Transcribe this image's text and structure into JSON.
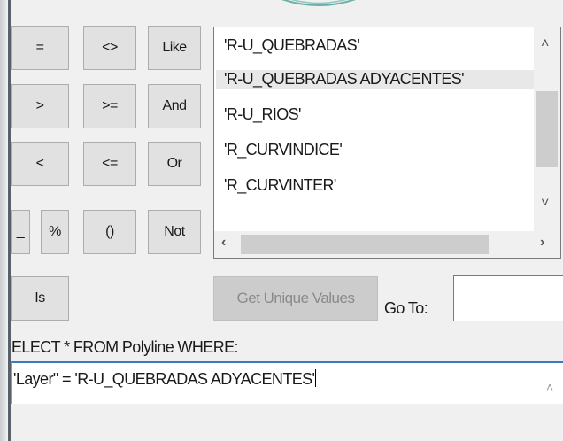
{
  "operators": {
    "row1": [
      "=",
      "<>",
      "Like"
    ],
    "row2": [
      ">",
      ">=",
      "And"
    ],
    "row3": [
      "<",
      "<=",
      "Or"
    ],
    "row4": [
      "_",
      "%",
      "()",
      "Not"
    ],
    "row5": [
      "Is"
    ]
  },
  "values_list": {
    "items": [
      "'R-U_QUEBRADAS'",
      "'R-U_QUEBRADAS ADYACENTES'",
      "'R-U_RIOS'",
      "'R_CURVINDICE'",
      "'R_CURVINTER'"
    ],
    "selected_index": 1
  },
  "get_unique_values_label": "Get Unique Values",
  "goto_label": "Go To:",
  "goto_value": "",
  "sql_label": "ELECT * FROM Polyline WHERE:",
  "sql_text": "'Layer\" = 'R-U_QUEBRADAS ADYACENTES'",
  "icons": {
    "scroll_up": "chevron-up-icon",
    "scroll_down": "chevron-down-icon",
    "scroll_left": "chevron-left-icon",
    "scroll_right": "chevron-right-icon"
  }
}
